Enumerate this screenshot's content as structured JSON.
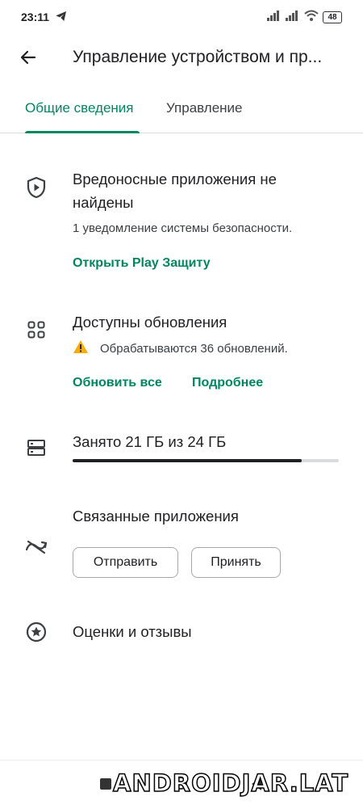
{
  "status_bar": {
    "time": "23:11",
    "battery": "48",
    "icons": [
      "telegram-icon",
      "signal-icon",
      "signal-icon",
      "wifi-icon",
      "battery-icon"
    ]
  },
  "app_bar": {
    "title": "Управление устройством и пр...",
    "back_icon": "arrow-back-icon"
  },
  "tabs": {
    "overview": "Общие сведения",
    "manage": "Управление",
    "active": "overview",
    "active_color": "#01875f"
  },
  "protect": {
    "icon": "shield-play-icon",
    "title_line1": "Вредоносные приложения не",
    "title_line2": "найдены",
    "subtitle": "1 уведомление системы безопасности.",
    "link": "Открыть Play Защиту"
  },
  "updates": {
    "icon": "apps-grid-icon",
    "title": "Доступны обновления",
    "warning_icon": "warning-icon",
    "warning_color": "#f9ab00",
    "warning_text": "Обрабатываются 36 обновлений.",
    "update_all": "Обновить все",
    "details": "Подробнее"
  },
  "storage": {
    "icon": "storage-icon",
    "text": "Занято 21 ГБ из 24 ГБ",
    "used_fraction": 0.86
  },
  "linked": {
    "icon": "sync-disabled-icon",
    "title": "Связанные приложения",
    "send": "Отправить",
    "receive": "Принять"
  },
  "ratings": {
    "icon": "star-circle-icon",
    "title": "Оценки и отзывы"
  },
  "nav": {
    "icons": [
      "recents-icon",
      "home-icon",
      "back-icon"
    ]
  },
  "watermark": "ANDROIDJAR.LAT"
}
